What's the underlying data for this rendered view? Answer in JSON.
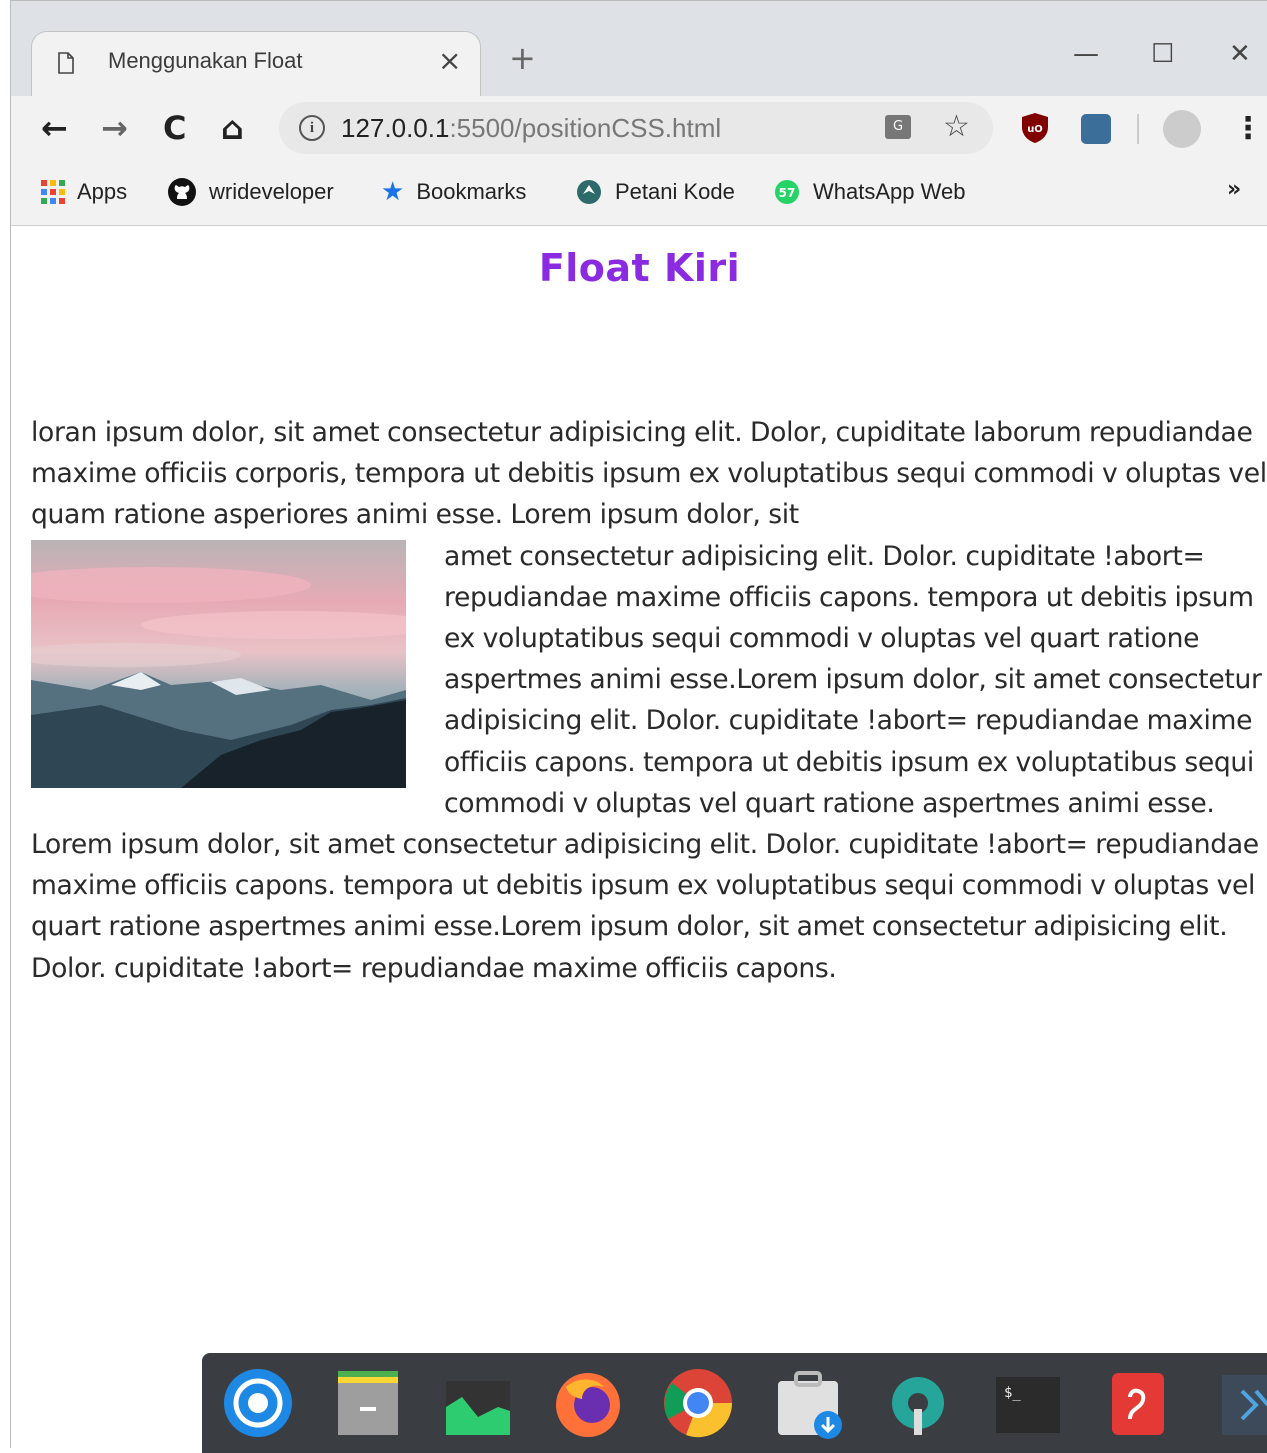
{
  "browser": {
    "tab": {
      "title": "Menggunakan Float",
      "close": "×"
    },
    "new_tab": "+",
    "window_controls": {
      "minimize": "—",
      "maximize": "☐",
      "close": "✕"
    },
    "nav": {
      "back": "←",
      "forward": "→",
      "reload": "C",
      "home": "⌂"
    },
    "address": {
      "host": "127.0.0.1",
      "path": ":5500/positionCSS.html"
    },
    "bookmarks": [
      {
        "label": "Apps",
        "icon": "apps-grid-icon"
      },
      {
        "label": "wrideveloper",
        "icon": "github-icon"
      },
      {
        "label": "Bookmarks",
        "icon": "star-icon"
      },
      {
        "label": "Petani Kode",
        "icon": "petanikode-icon"
      },
      {
        "label": "WhatsApp Web",
        "icon": "whatsapp-icon",
        "badge": "57"
      }
    ],
    "more": "»"
  },
  "page": {
    "heading": "Float Kiri",
    "text_before": "loran ipsum dolor, sit amet consectetur adipisicing elit. Dolor, cupiditate laborum repudiandae maxime officiis corporis, tempora ut debitis ipsum ex voluptatibus sequi commodi v oluptas vel quam ratione asperiores animi esse. Lorem ipsum dolor, sit",
    "text_after": "amet consectetur adipisicing elit. Dolor. cupiditate !abort= repudiandae maxime officiis capons. tempora ut debitis ipsum ex voluptatibus sequi commodi v oluptas vel quart ratione aspertmes animi esse.Lorem ipsum dolor, sit amet consectetur adipisicing elit. Dolor. cupiditate !abort= repudiandae maxime officiis capons. tempora ut debitis ipsum ex voluptatibus sequi commodi v oluptas vel quart ratione aspertmes animi esse. Lorem ipsum dolor, sit amet consectetur adipisicing elit. Dolor. cupiditate !abort= repudiandae maxime officiis capons. tempora ut debitis ipsum ex voluptatibus sequi commodi v oluptas vel quart ratione aspertmes animi esse.Lorem ipsum dolor, sit amet consectetur adipisicing elit. Dolor. cupiditate !abort= repudiandae maxime officiis capons."
  },
  "dock": [
    {
      "icon": "deepin-launcher-icon"
    },
    {
      "icon": "file-manager-icon"
    },
    {
      "icon": "system-monitor-icon"
    },
    {
      "icon": "firefox-icon"
    },
    {
      "icon": "chrome-icon"
    },
    {
      "icon": "app-store-icon"
    },
    {
      "icon": "settings-icon"
    },
    {
      "icon": "terminal-icon",
      "label": "$_"
    },
    {
      "icon": "wps-pdf-icon"
    },
    {
      "icon": "vscode-icon"
    }
  ]
}
